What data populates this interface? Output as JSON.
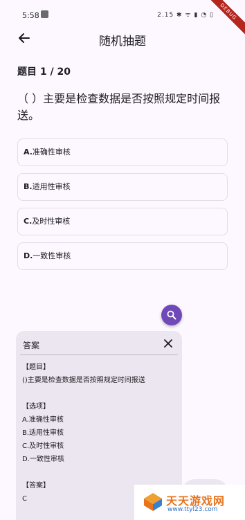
{
  "status_bar": {
    "time": "5:58",
    "indicators": "2.15 ✱ ᯤ ▮ ◔ ▯",
    "debug_label": "DEBUG"
  },
  "app_bar": {
    "title": "随机抽题",
    "back_icon": "arrow-left-icon"
  },
  "question": {
    "progress": "题目 1 / 20",
    "text": "（  ）主要是检查数据是否按照规定时间报送。",
    "options": [
      {
        "letter": "A.",
        "text": "准确性审核"
      },
      {
        "letter": "B.",
        "text": "适用性审核"
      },
      {
        "letter": "C.",
        "text": "及时性审核"
      },
      {
        "letter": "D.",
        "text": "一致性审核"
      }
    ]
  },
  "search_fab": {
    "icon": "search-icon",
    "color": "#7049b9"
  },
  "answer_panel": {
    "title": "答案",
    "close_icon": "close-icon",
    "question_heading": "【题目】",
    "question_text": "()主要是检查数据是否按照规定时间报送",
    "options_heading": "【选项】",
    "options": [
      "A.准确性审核",
      "B.适用性审核",
      "C.及时性审核",
      "D.一致性审核"
    ],
    "answer_heading": "【答案】",
    "answer": "C"
  },
  "watermark": {
    "name": "天天游戏网",
    "url": "www.ttyl23.com"
  }
}
